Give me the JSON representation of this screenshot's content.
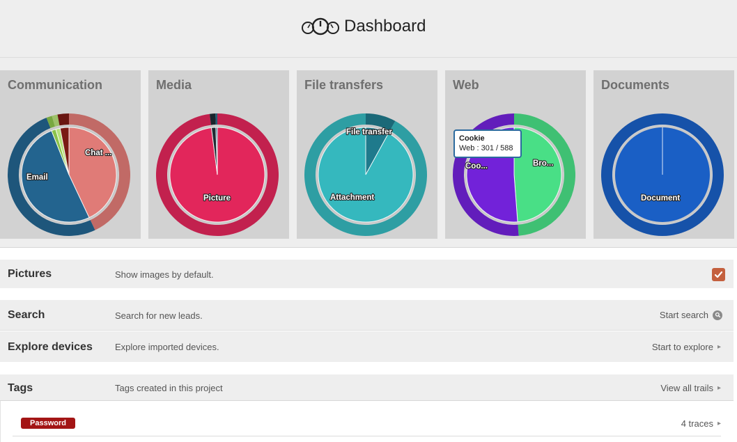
{
  "header": {
    "title": "Dashboard",
    "logo_icon": "speedometer-logo-icon"
  },
  "charts": [
    {
      "title": "Communication",
      "labels": [
        "Email",
        "Chat ..."
      ]
    },
    {
      "title": "Media",
      "labels": [
        "Picture"
      ]
    },
    {
      "title": "File transfers",
      "labels": [
        "File transfer",
        "Attachment"
      ]
    },
    {
      "title": "Web",
      "labels": [
        "Coo...",
        "Bro..."
      ]
    },
    {
      "title": "Documents",
      "labels": [
        "Document"
      ]
    }
  ],
  "tooltip": {
    "title": "Cookie",
    "value": "Web : 301 / 588"
  },
  "chart_data": [
    {
      "type": "pie",
      "title": "Communication",
      "categories": [
        "Chat ...",
        "Email",
        "other-1",
        "other-2",
        "other-3"
      ],
      "values": [
        43,
        51,
        1.5,
        1.5,
        3
      ],
      "colors": [
        "#e07b77",
        "#23648f",
        "#8bc34a",
        "#b6e07a",
        "#7a1a14"
      ]
    },
    {
      "type": "pie",
      "title": "Media",
      "categories": [
        "Picture",
        "other-1",
        "other-2"
      ],
      "values": [
        98,
        1.5,
        0.5
      ],
      "colors": [
        "#e2265b",
        "#1e2a33",
        "#2a6f8a"
      ]
    },
    {
      "type": "pie",
      "title": "File transfers",
      "categories": [
        "File transfer",
        "Attachment"
      ],
      "values": [
        8,
        92
      ],
      "colors": [
        "#1f7a8c",
        "#35b8be"
      ]
    },
    {
      "type": "pie",
      "title": "Web",
      "categories": [
        "Bro...",
        "Coo..."
      ],
      "values": [
        287,
        301
      ],
      "colors": [
        "#49df86",
        "#7222d9"
      ]
    },
    {
      "type": "pie",
      "title": "Documents",
      "categories": [
        "Document"
      ],
      "values": [
        100
      ],
      "colors": [
        "#1a5fc5"
      ]
    }
  ],
  "settings": {
    "pictures": {
      "label": "Pictures",
      "description": "Show images by default.",
      "checked": true
    },
    "search": {
      "label": "Search",
      "description": "Search for new leads.",
      "action": "Start search"
    },
    "explore": {
      "label": "Explore devices",
      "description": "Explore imported devices.",
      "action": "Start to explore"
    },
    "tags": {
      "label": "Tags",
      "description": "Tags created in this project",
      "action": "View all trails"
    }
  },
  "tags_list": [
    {
      "name": "Password",
      "count": "4 traces",
      "color": "#a31515"
    }
  ]
}
